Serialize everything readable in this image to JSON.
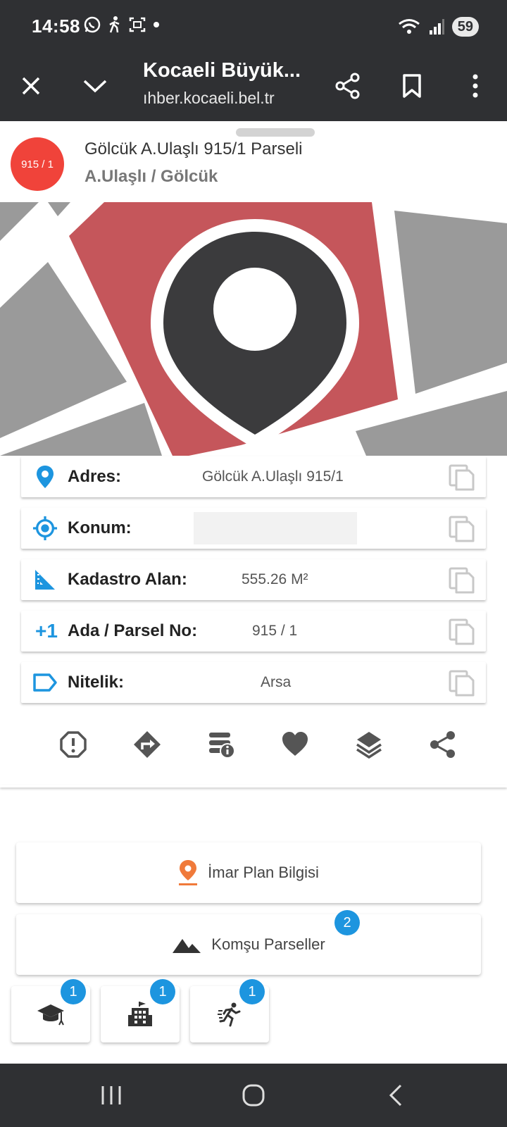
{
  "status_bar": {
    "time": "14:58",
    "battery": "59",
    "left_icons": [
      "whatsapp-icon",
      "walking-icon",
      "screenshot-icon",
      "dot-icon"
    ],
    "right_icons": [
      "wifi-icon",
      "signal-icon",
      "battery-icon"
    ]
  },
  "browser": {
    "title": "Kocaeli Büyük...",
    "url": "ıhber.kocaeli.bel.tr",
    "icons": [
      "close-icon",
      "chevron-down-icon",
      "share-icon",
      "bookmark-icon",
      "more-vert-icon"
    ]
  },
  "parcel": {
    "badge": "915 / 1",
    "title": "Gölcük A.Ulaşlı 915/1 Parseli",
    "subtitle": "A.Ulaşlı / Gölcük"
  },
  "info_rows": [
    {
      "label": "Adres:",
      "value": "Gölcük A.Ulaşlı 915/1",
      "icon": "location-pin-icon"
    },
    {
      "label": "Konum:",
      "value": "",
      "icon": "crosshair-icon"
    },
    {
      "label": "Kadastro Alan:",
      "value": "555.26 M²",
      "icon": "area-ruler-icon"
    },
    {
      "label": "Ada / Parsel No:",
      "value": "915 / 1",
      "icon": "plus-one-icon",
      "icon_text": "+1"
    },
    {
      "label": "Nitelik:",
      "value": "Arsa",
      "icon": "label-tag-icon"
    }
  ],
  "actions": [
    "report-icon",
    "directions-icon",
    "info-list-icon",
    "favorite-icon",
    "layers-icon",
    "share-icon"
  ],
  "cards": {
    "imar": {
      "label": "İmar Plan Bilgisi"
    },
    "komsu": {
      "label": "Komşu Parseller",
      "count": "2"
    },
    "small": [
      {
        "icon": "graduation-cap-icon",
        "count": "1"
      },
      {
        "icon": "building-icon",
        "count": "1"
      },
      {
        "icon": "running-icon",
        "count": "1"
      }
    ]
  },
  "colors": {
    "bar": "#2f3033",
    "badge_red": "#f0433a",
    "parcel_red": "#c5565b",
    "accent_blue": "#1d95df",
    "accent_orange": "#f07a3a"
  }
}
